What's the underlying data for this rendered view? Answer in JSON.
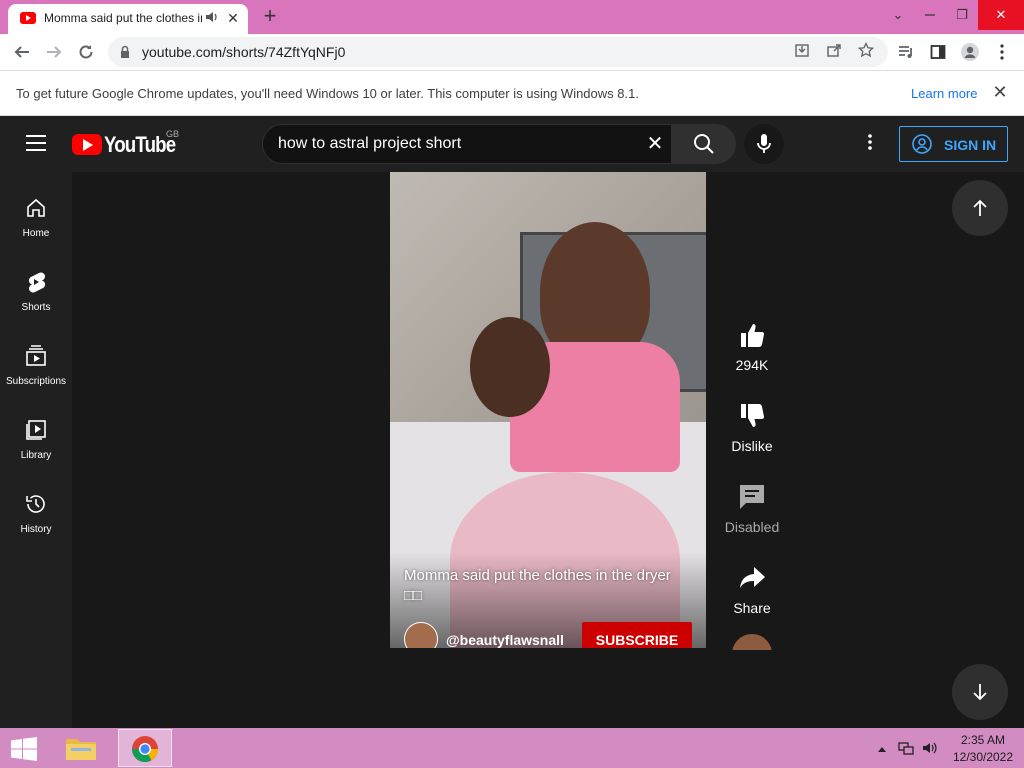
{
  "browser": {
    "tab_title": "Momma said put the clothes in the dryer",
    "new_tab_glyph": "+",
    "url": "youtube.com/shorts/74ZftYqNFj0",
    "window_controls": {
      "chevron": "⌄",
      "restore": "❐",
      "close": "✕"
    },
    "icons": [
      "back-arrow-icon",
      "forward-arrow-icon",
      "reload-icon",
      "lock-icon",
      "install-icon",
      "share-icon",
      "star-icon",
      "media-icon",
      "side-panel-icon",
      "profile-icon",
      "menu-icon"
    ]
  },
  "infobar": {
    "message": "To get future Google Chrome updates, you'll need Windows 10 or later. This computer is using Windows 8.1.",
    "link": "Learn more",
    "close_glyph": "✕"
  },
  "youtube": {
    "logo_text": "YouTube",
    "region": "GB",
    "search_query": "how to astral project short",
    "sign_in": "SIGN IN",
    "accent": "#3ea6ff",
    "brand_red": "#ff0000",
    "sidebar": [
      {
        "label": "Home",
        "icon": "home-icon"
      },
      {
        "label": "Shorts",
        "icon": "shorts-icon"
      },
      {
        "label": "Subscriptions",
        "icon": "subscriptions-icon"
      },
      {
        "label": "Library",
        "icon": "library-icon"
      },
      {
        "label": "History",
        "icon": "history-icon"
      }
    ],
    "short": {
      "caption": "Momma said put the clothes in the dryer",
      "caption_glyphs": "□□",
      "channel": "@beautyflawsnall",
      "subscribe": "SUBSCRIBE"
    },
    "actions": [
      {
        "label": "294K",
        "icon": "like-icon"
      },
      {
        "label": "Dislike",
        "icon": "dislike-icon"
      },
      {
        "label": "Disabled",
        "icon": "comments-icon"
      },
      {
        "label": "Share",
        "icon": "share-icon"
      }
    ]
  },
  "taskbar": {
    "time": "2:35 AM",
    "date": "12/30/2022",
    "apps": [
      "file-explorer-icon",
      "chrome-icon"
    ],
    "tray": [
      "tray-expand-icon",
      "network-icon",
      "volume-icon"
    ]
  }
}
